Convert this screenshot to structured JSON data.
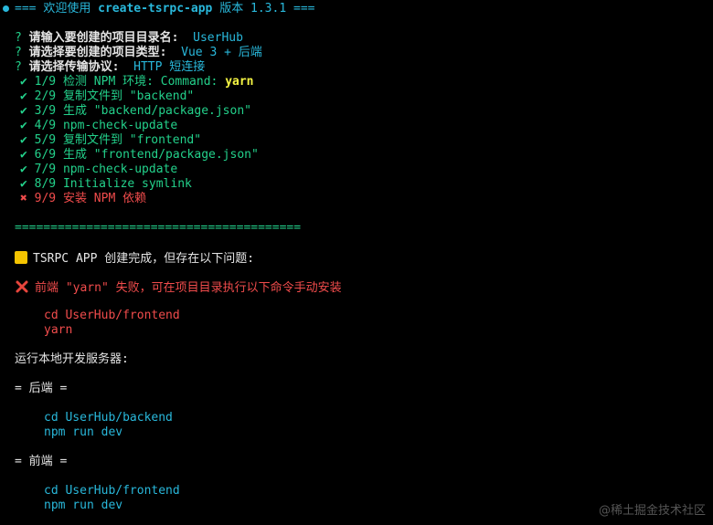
{
  "header": {
    "prefix": "=== ",
    "welcome": "欢迎使用 ",
    "app_name": "create-tsrpc-app",
    "version_label": " 版本 ",
    "version": "1.3.1",
    "suffix": " ==="
  },
  "prompts": [
    {
      "mark": "?",
      "question": "请输入要创建的项目目录名:",
      "answer": "UserHub"
    },
    {
      "mark": "?",
      "question": "请选择要创建的项目类型:",
      "answer": "Vue 3 + 后端"
    },
    {
      "mark": "?",
      "question": "请选择传输协议:",
      "answer": "HTTP 短连接"
    }
  ],
  "steps": [
    {
      "mark": "✔",
      "text": "1/9 检测 NPM 环境: Command: ",
      "highlight": "yarn"
    },
    {
      "mark": "✔",
      "text": "2/9 复制文件到 \"backend\""
    },
    {
      "mark": "✔",
      "text": "3/9 生成 \"backend/package.json\""
    },
    {
      "mark": "✔",
      "text": "4/9 npm-check-update"
    },
    {
      "mark": "✔",
      "text": "5/9 复制文件到 \"frontend\""
    },
    {
      "mark": "✔",
      "text": "6/9 生成 \"frontend/package.json\""
    },
    {
      "mark": "✔",
      "text": "7/9 npm-check-update"
    },
    {
      "mark": "✔",
      "text": "8/9 Initialize symlink"
    },
    {
      "mark": "✖",
      "text": "9/9 安装 NPM 依赖"
    }
  ],
  "separator": "========================================",
  "summary": {
    "warning": "TSRPC APP 创建完成，但存在以下问题:",
    "error": "前端 \"yarn\" 失败，可在项目目录执行以下命令手动安装",
    "error_cmds": [
      "cd UserHub/frontend",
      "yarn"
    ],
    "run_title": "运行本地开发服务器:",
    "backend_title": "= 后端 =",
    "backend_cmds": [
      "cd UserHub/backend",
      "npm run dev"
    ],
    "frontend_title": "= 前端 =",
    "frontend_cmds": [
      "cd UserHub/frontend",
      "npm run dev"
    ]
  },
  "watermark": "@稀土掘金技术社区",
  "colors": {
    "background": "#000000",
    "cyan": "#29b8db",
    "green": "#23d18b",
    "red": "#f14c4c",
    "yellow": "#f5f543"
  }
}
